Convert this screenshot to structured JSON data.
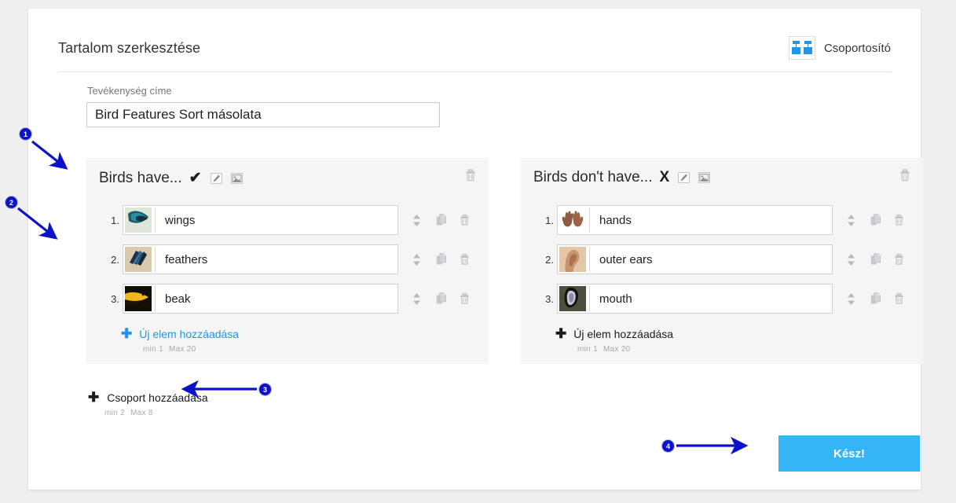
{
  "header": {
    "title": "Tartalom szerkesztése",
    "mode_label": "Csoportosító",
    "mode_icon": "group-sort-icon"
  },
  "title_field": {
    "label": "Tevékenység címe",
    "value": "Bird Features Sort másolata",
    "placeholder": "Tevékenység címe"
  },
  "groups": [
    {
      "title": "Birds have...",
      "symbol": "✔",
      "edit_icon": "edit-pencil-icon",
      "image_icon": "image-icon",
      "delete_icon": "trash-icon",
      "items": [
        {
          "index": "1.",
          "text": "wings",
          "thumb": "bird-wing-photo"
        },
        {
          "index": "2.",
          "text": "feathers",
          "thumb": "feathers-photo"
        },
        {
          "index": "3.",
          "text": "beak",
          "thumb": "toucan-beak-photo"
        }
      ],
      "add_item_label": "Új elem hozzáadása",
      "add_item_style": "blue",
      "min_label": "min 1",
      "max_label": "Max 20"
    },
    {
      "title": "Birds don't have...",
      "symbol": "X",
      "edit_icon": "edit-pencil-icon",
      "image_icon": "image-icon",
      "delete_icon": "trash-icon",
      "items": [
        {
          "index": "1.",
          "text": "hands",
          "thumb": "hands-photo"
        },
        {
          "index": "2.",
          "text": "outer ears",
          "thumb": "ear-photo"
        },
        {
          "index": "3.",
          "text": "mouth",
          "thumb": "mouth-photo"
        }
      ],
      "add_item_label": "Új elem hozzáadása",
      "add_item_style": "dark",
      "min_label": "min 1",
      "max_label": "Max 20"
    }
  ],
  "add_group": {
    "label": "Csoport hozzáadása",
    "min_label": "min 2",
    "max_label": "Max 8"
  },
  "done_button": {
    "label": "Kész!"
  },
  "row_actions": {
    "reorder_icon": "sort-updown-icon",
    "duplicate_icon": "duplicate-icon",
    "delete_icon": "trash-icon"
  },
  "annotations": [
    {
      "number": "1"
    },
    {
      "number": "2"
    },
    {
      "number": "3"
    },
    {
      "number": "4"
    }
  ],
  "colors": {
    "accent": "#2196e8",
    "button": "#35b5f5",
    "annotation": "#0c12c9",
    "panel_bg": "#f5f5f5",
    "page_bg": "#efefef"
  }
}
